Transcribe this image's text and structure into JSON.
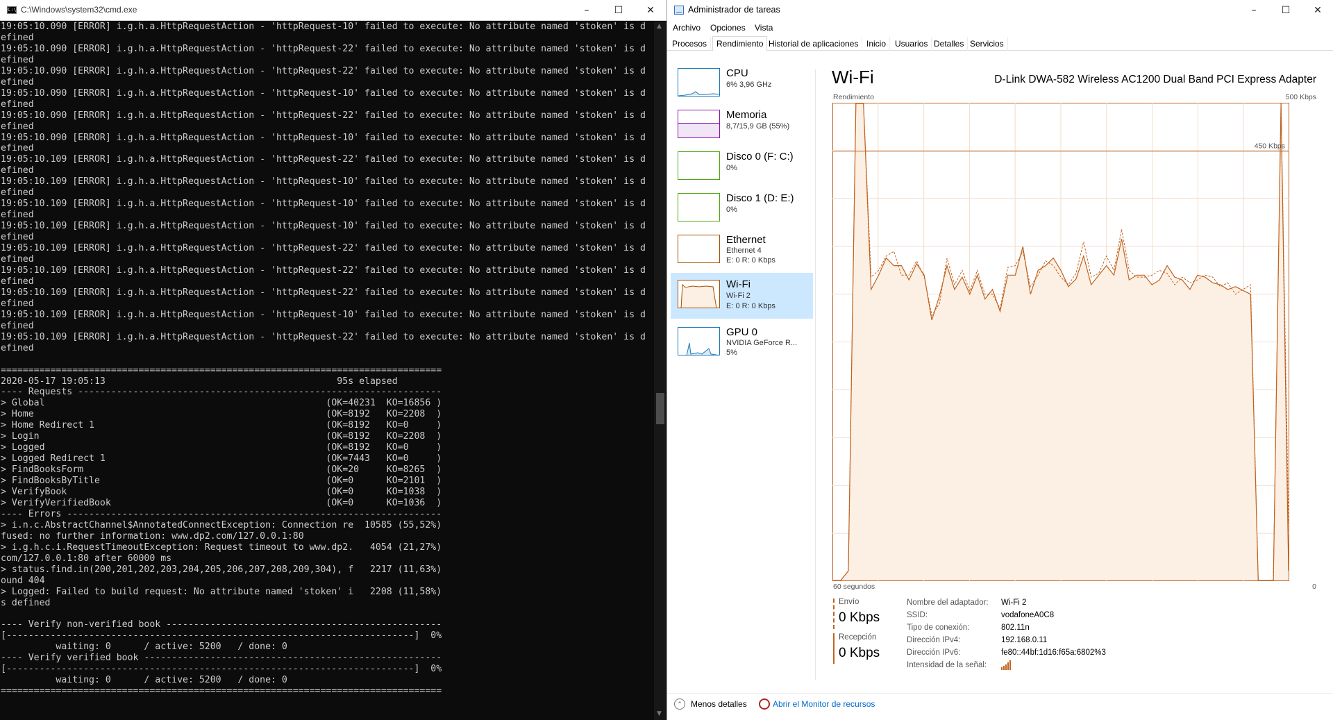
{
  "cmd": {
    "title": "C:\\Windows\\system32\\cmd.exe",
    "lines": [
      "19:05:10.090 [ERROR] i.g.h.a.HttpRequestAction - 'httpRequest-10' failed to execute: No attribute named 'stoken' is d",
      "efined",
      "19:05:10.090 [ERROR] i.g.h.a.HttpRequestAction - 'httpRequest-22' failed to execute: No attribute named 'stoken' is d",
      "efined",
      "19:05:10.090 [ERROR] i.g.h.a.HttpRequestAction - 'httpRequest-22' failed to execute: No attribute named 'stoken' is d",
      "efined",
      "19:05:10.090 [ERROR] i.g.h.a.HttpRequestAction - 'httpRequest-10' failed to execute: No attribute named 'stoken' is d",
      "efined",
      "19:05:10.090 [ERROR] i.g.h.a.HttpRequestAction - 'httpRequest-22' failed to execute: No attribute named 'stoken' is d",
      "efined",
      "19:05:10.090 [ERROR] i.g.h.a.HttpRequestAction - 'httpRequest-10' failed to execute: No attribute named 'stoken' is d",
      "efined",
      "19:05:10.109 [ERROR] i.g.h.a.HttpRequestAction - 'httpRequest-22' failed to execute: No attribute named 'stoken' is d",
      "efined",
      "19:05:10.109 [ERROR] i.g.h.a.HttpRequestAction - 'httpRequest-10' failed to execute: No attribute named 'stoken' is d",
      "efined",
      "19:05:10.109 [ERROR] i.g.h.a.HttpRequestAction - 'httpRequest-10' failed to execute: No attribute named 'stoken' is d",
      "efined",
      "19:05:10.109 [ERROR] i.g.h.a.HttpRequestAction - 'httpRequest-10' failed to execute: No attribute named 'stoken' is d",
      "efined",
      "19:05:10.109 [ERROR] i.g.h.a.HttpRequestAction - 'httpRequest-22' failed to execute: No attribute named 'stoken' is d",
      "efined",
      "19:05:10.109 [ERROR] i.g.h.a.HttpRequestAction - 'httpRequest-22' failed to execute: No attribute named 'stoken' is d",
      "efined",
      "19:05:10.109 [ERROR] i.g.h.a.HttpRequestAction - 'httpRequest-22' failed to execute: No attribute named 'stoken' is d",
      "efined",
      "19:05:10.109 [ERROR] i.g.h.a.HttpRequestAction - 'httpRequest-10' failed to execute: No attribute named 'stoken' is d",
      "efined",
      "19:05:10.109 [ERROR] i.g.h.a.HttpRequestAction - 'httpRequest-22' failed to execute: No attribute named 'stoken' is d",
      "efined",
      "",
      "================================================================================",
      "2020-05-17 19:05:13                                          95s elapsed",
      "---- Requests ------------------------------------------------------------------",
      "> Global                                                   (OK=40231  KO=16856 )",
      "> Home                                                     (OK=8192   KO=2208  )",
      "> Home Redirect 1                                          (OK=8192   KO=0     )",
      "> Login                                                    (OK=8192   KO=2208  )",
      "> Logged                                                   (OK=8192   KO=0     )",
      "> Logged Redirect 1                                        (OK=7443   KO=0     )",
      "> FindBooksForm                                            (OK=20     KO=8265  )",
      "> FindBooksByTitle                                         (OK=0      KO=2101  )",
      "> VerifyBook                                               (OK=0      KO=1038  )",
      "> VerifyVerifiedBook                                       (OK=0      KO=1036  )",
      "---- Errors --------------------------------------------------------------------",
      "> i.n.c.AbstractChannel$AnnotatedConnectException: Connection re  10585 (55,52%)",
      "fused: no further information: www.dp2.com/127.0.0.1:80",
      "> i.g.h.c.i.RequestTimeoutException: Request timeout to www.dp2.   4054 (21,27%)",
      "com/127.0.0.1:80 after 60000 ms",
      "> status.find.in(200,201,202,203,204,205,206,207,208,209,304), f   2217 (11,63%)",
      "ound 404",
      "> Logged: Failed to build request: No attribute named 'stoken' i   2208 (11,58%)",
      "s defined",
      "",
      "---- Verify non-verified book --------------------------------------------------",
      "[--------------------------------------------------------------------------]  0%",
      "          waiting: 0      / active: 5200   / done: 0",
      "---- Verify verified book ------------------------------------------------------",
      "[--------------------------------------------------------------------------]  0%",
      "          waiting: 0      / active: 5200   / done: 0",
      "================================================================================"
    ]
  },
  "taskmgr": {
    "title": "Administrador de tareas",
    "menu": [
      "Archivo",
      "Opciones",
      "Vista"
    ],
    "tabs": [
      "Procesos",
      "Rendimiento",
      "Historial de aplicaciones",
      "Inicio",
      "Usuarios",
      "Detalles",
      "Servicios"
    ],
    "active_tab": "Rendimiento",
    "sidebar": [
      {
        "name": "CPU",
        "sub": [
          "6% 3,96 GHz"
        ],
        "color": "#1a7ab8"
      },
      {
        "name": "Memoria",
        "sub": [
          "8,7/15,9 GB (55%)"
        ],
        "color": "#8b12ae"
      },
      {
        "name": "Disco 0 (F: C:)",
        "sub": [
          "0%"
        ],
        "color": "#4da60c"
      },
      {
        "name": "Disco 1 (D: E:)",
        "sub": [
          "0%"
        ],
        "color": "#4da60c"
      },
      {
        "name": "Ethernet",
        "sub": [
          "Ethernet 4",
          "E: 0 R: 0 Kbps"
        ],
        "color": "#a74f01"
      },
      {
        "name": "Wi-Fi",
        "sub": [
          "Wi-Fi 2",
          "E: 0 R: 0 Kbps"
        ],
        "color": "#a74f01"
      },
      {
        "name": "GPU 0",
        "sub": [
          "NVIDIA GeForce R...",
          "5%"
        ],
        "color": "#1a7ab8"
      }
    ],
    "main": {
      "title": "Wi-Fi",
      "adapter": "D-Link DWA-582 Wireless AC1200 Dual Band PCI Express Adapter",
      "chart_label": "Rendimiento",
      "chart_max": "500 Kbps",
      "chart_mid": "450 Kbps",
      "x_left": "60 segundos",
      "x_right": "0",
      "send_label": "Envío",
      "send_value": "0 Kbps",
      "recv_label": "Recepción",
      "recv_value": "0 Kbps",
      "props": [
        {
          "k": "Nombre del adaptador:",
          "v": "Wi-Fi 2"
        },
        {
          "k": "SSID:",
          "v": "vodafoneA0C8"
        },
        {
          "k": "Tipo de conexión:",
          "v": "802.11n"
        },
        {
          "k": "Dirección IPv4:",
          "v": "192.168.0.11"
        },
        {
          "k": "Dirección IPv6:",
          "v": "fe80::44bf:1d16:f65a:6802%3"
        },
        {
          "k": "Intensidad de la señal:",
          "v": ""
        }
      ]
    },
    "footer": {
      "fewer": "Menos detalles",
      "resmon": "Abrir el Monitor de recursos"
    }
  },
  "chart_data": {
    "type": "line",
    "ylim": [
      0,
      500
    ],
    "x": [
      0,
      1,
      2,
      3,
      4,
      5,
      6,
      7,
      8,
      9,
      10,
      11,
      12,
      13,
      14,
      15,
      16,
      17,
      18,
      19,
      20,
      21,
      22,
      23,
      24,
      25,
      26,
      27,
      28,
      29,
      30,
      31,
      32,
      33,
      34,
      35,
      36,
      37,
      38,
      39,
      40,
      41,
      42,
      43,
      44,
      45,
      46,
      47,
      48,
      49,
      50,
      51,
      52,
      53,
      54,
      55,
      56,
      57,
      58,
      59,
      60
    ],
    "series": [
      {
        "values": [
          0,
          0,
          10,
          500,
          500,
          305,
          320,
          338,
          330,
          330,
          315,
          332,
          320,
          273,
          298,
          330,
          305,
          318,
          300,
          320,
          295,
          305,
          282,
          320,
          320,
          350,
          300,
          325,
          330,
          338,
          325,
          308,
          316,
          340,
          310,
          320,
          330,
          320,
          358,
          315,
          320,
          320,
          310,
          315,
          330,
          318,
          315,
          305,
          320,
          318,
          312,
          310,
          305,
          308,
          304,
          300,
          0,
          0,
          0,
          500,
          10
        ]
      },
      {
        "values": [
          0,
          0,
          10,
          500,
          500,
          318,
          325,
          340,
          345,
          320,
          320,
          335,
          318,
          278,
          290,
          338,
          310,
          325,
          303,
          325,
          300,
          300,
          285,
          328,
          330,
          345,
          308,
          320,
          335,
          330,
          318,
          310,
          322,
          355,
          318,
          322,
          340,
          325,
          368,
          325,
          318,
          318,
          320,
          325,
          322,
          310,
          318,
          312,
          315,
          320,
          318,
          308,
          312,
          300,
          305,
          310,
          0,
          0,
          0,
          500,
          60
        ]
      }
    ]
  }
}
